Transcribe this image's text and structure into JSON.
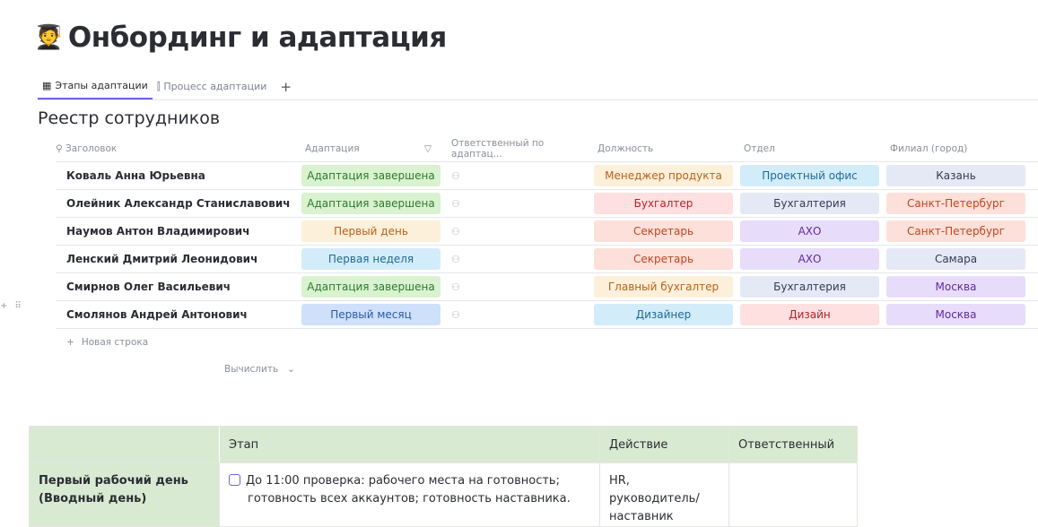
{
  "page": {
    "emoji": "🧑‍🎓",
    "title": "Онбординг и адаптация"
  },
  "tabs": [
    {
      "label": "Этапы адаптации",
      "icon": "table-icon",
      "active": true
    },
    {
      "label": "Процесс адаптации",
      "icon": "kanban-icon",
      "active": false
    }
  ],
  "tab_add": "+",
  "section_title": "Реестр сотрудников",
  "columns": [
    "Заголовок",
    "Адаптация",
    "Ответственный по адаптац...",
    "Должность",
    "Отдел",
    "Филиал (город)"
  ],
  "rows": [
    {
      "name": "Коваль Анна Юрьевна",
      "adapt": {
        "text": "Адаптация завершена",
        "tone": "green"
      },
      "role": {
        "text": "Менеджер продукта",
        "tone": "orange"
      },
      "dept": {
        "text": "Проектный офис",
        "tone": "cyan"
      },
      "city": {
        "text": "Казань",
        "tone": "gray"
      }
    },
    {
      "name": "Олейник Александр Станиславович",
      "adapt": {
        "text": "Адаптация завершена",
        "tone": "green"
      },
      "role": {
        "text": "Бухгалтер",
        "tone": "red"
      },
      "dept": {
        "text": "Бухгалтерия",
        "tone": "gray"
      },
      "city": {
        "text": "Санкт-Петербург",
        "tone": "salmon"
      }
    },
    {
      "name": "Наумов Антон Владимирович",
      "adapt": {
        "text": "Первый день",
        "tone": "orange"
      },
      "role": {
        "text": "Секретарь",
        "tone": "salmon"
      },
      "dept": {
        "text": "АХО",
        "tone": "purple"
      },
      "city": {
        "text": "Санкт-Петербург",
        "tone": "salmon"
      }
    },
    {
      "name": "Ленский Дмитрий Леонидович",
      "adapt": {
        "text": "Первая неделя",
        "tone": "cyan"
      },
      "role": {
        "text": "Секретарь",
        "tone": "salmon"
      },
      "dept": {
        "text": "АХО",
        "tone": "purple"
      },
      "city": {
        "text": "Самара",
        "tone": "gray"
      }
    },
    {
      "name": "Смирнов Олег Васильевич",
      "adapt": {
        "text": "Адаптация завершена",
        "tone": "green"
      },
      "role": {
        "text": "Главный бухгалтер",
        "tone": "orange"
      },
      "dept": {
        "text": "Бухгалтерия",
        "tone": "gray"
      },
      "city": {
        "text": "Москва",
        "tone": "purple"
      }
    },
    {
      "name": "Смолянов Андрей Антонович",
      "adapt": {
        "text": "Первый месяц",
        "tone": "blue"
      },
      "role": {
        "text": "Дизайнер",
        "tone": "cyan"
      },
      "dept": {
        "text": "Дизайн",
        "tone": "red"
      },
      "city": {
        "text": "Москва",
        "tone": "purple"
      }
    }
  ],
  "new_row": "Новая строка",
  "calculate": "Вычислить",
  "stages": {
    "headers": [
      "",
      "Этап",
      "Действие",
      "Ответственный"
    ],
    "rows": [
      {
        "label_line1": "Первый рабочий день",
        "label_line2": "(Вводный день)",
        "stage_line1": "До 11:00 проверка: рабочего места на готовность;",
        "stage_line2": "готовность всех аккаунтов; готовность наставника.",
        "action_line1": "HR, руководитель/",
        "action_line2": "наставник",
        "responsible": ""
      }
    ]
  }
}
